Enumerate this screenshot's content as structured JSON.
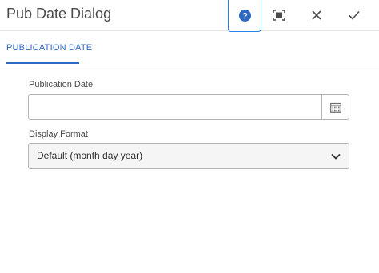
{
  "dialog": {
    "title": "Pub Date Dialog",
    "icons": {
      "help": "help-icon",
      "fullscreen": "fullscreen-icon",
      "close": "close-icon",
      "done": "checkmark-icon"
    }
  },
  "tabs": [
    {
      "label": "PUBLICATION DATE",
      "active": true
    }
  ],
  "form": {
    "publication_date": {
      "label": "Publication Date",
      "value": "",
      "icon": "calendar-icon"
    },
    "display_format": {
      "label": "Display Format",
      "selected": "Default (month day year)",
      "icon": "chevron-down-icon"
    }
  },
  "colors": {
    "accent": "#2c67c2",
    "focus_border": "#2680eb",
    "border": "#b3b3b3"
  }
}
